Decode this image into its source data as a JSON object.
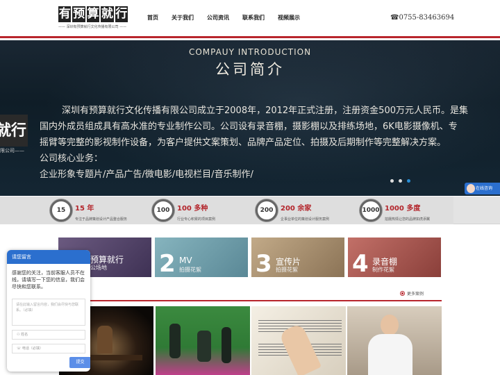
{
  "header": {
    "logo_chars": [
      "有",
      "预",
      "算",
      "就",
      "行"
    ],
    "logo_sub": "—— 深圳有预算就行文化传播有限公司 ——",
    "nav": [
      "首页",
      "关于我们",
      "公司资讯",
      "联系我们",
      "视频展示"
    ],
    "phone": "☎0755-83463694"
  },
  "banner": {
    "title_en": "COMPAUY INTRODUCTION",
    "title_zh": "公司简介",
    "left_box": "就行",
    "left_sub": "限公司——",
    "paragraph_lines": [
      "深圳有预算就行文化传播有限公司成立于2008年，2012年正式注册，注册资金500万元人民币。是集",
      "国内外成员组成具有高水准的专业制作公司。公司设有录音棚，摄影棚以及排练场地，6K电影摄像机、专",
      "摇臂等完整的影视制作设备，为客户提供文案策划、品牌产品定位、拍摄及后期制作等完整解决方案。",
      "公司核心业务：",
      "企业形象专题片/产品广告/微电影/电视栏目/音乐制作/"
    ],
    "slide_count": 3,
    "active_slide": 3,
    "consult_label": "在线咨询"
  },
  "stats": [
    {
      "badge": "15",
      "num": "15 年",
      "desc": "专注于品牌策划设计产品整合服务"
    },
    {
      "badge": "100",
      "num": "100 多种",
      "desc": "行业专心积累的项目案例"
    },
    {
      "badge": "200",
      "num": "200 余家",
      "desc": "企事业单位的策划设计服务案例"
    },
    {
      "badge": "1000",
      "num": "1000 多度",
      "desc": "拍摄热情让您的品牌如虎添翼"
    }
  ],
  "categories": [
    {
      "num": "",
      "t1": "预算就行",
      "t2": "公场地",
      "color": "#5a4a6e"
    },
    {
      "num": "2",
      "t1": "MV",
      "t2": "拍摄花絮",
      "color": "#6f9fac"
    },
    {
      "num": "3",
      "t1": "宣传片",
      "t2": "拍摄花絮",
      "color": "#a99170"
    },
    {
      "num": "4",
      "t1": "录音棚",
      "t2": "制作花絮",
      "color": "#a5574f"
    }
  ],
  "cases": {
    "more_label": "更多案例"
  },
  "chat": {
    "title": "请您留言",
    "body": "感谢您的关注，当前客服人员不在线，请填写一下您的信息，我们会尽快和您联系。",
    "textarea_placeholder": "请在此输入留言内容，我们会尽快与您联系。（必填）",
    "name_placeholder": "姓名",
    "phone_placeholder": "电话（必填）",
    "submit": "提交"
  }
}
